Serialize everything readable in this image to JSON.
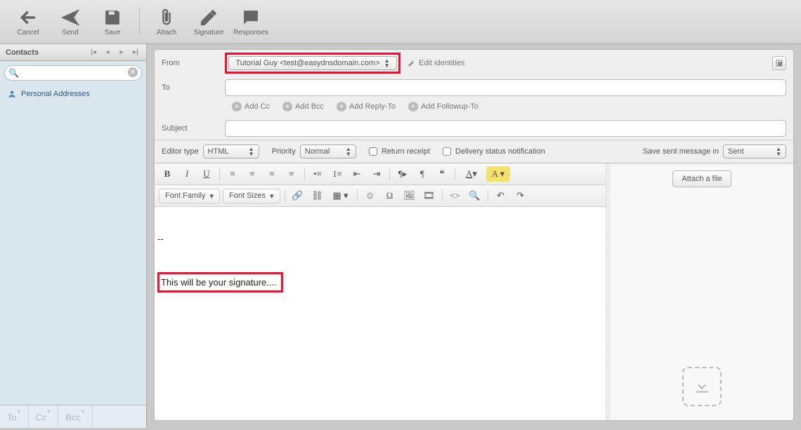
{
  "toolbar": {
    "cancel": "Cancel",
    "send": "Send",
    "save": "Save",
    "attach": "Attach",
    "signature": "Signature",
    "responses": "Responses"
  },
  "sidebar": {
    "title": "Contacts",
    "search_placeholder": "",
    "items": [
      {
        "label": "Personal Addresses"
      }
    ],
    "footer": {
      "to": "To",
      "cc": "Cc",
      "bcc": "Bcc"
    }
  },
  "compose": {
    "from_label": "From",
    "to_label": "To",
    "subject_label": "Subject",
    "from_value": "Tutorial Guy <test@easydnsdomain.com>",
    "edit_identities": "Edit identities",
    "add_cc": "Add Cc",
    "add_bcc": "Add Bcc",
    "add_replyto": "Add Reply-To",
    "add_followup": "Add Followup-To",
    "to_value": "",
    "subject_value": ""
  },
  "options": {
    "editor_type_label": "Editor type",
    "editor_type_value": "HTML",
    "priority_label": "Priority",
    "priority_value": "Normal",
    "return_receipt": "Return receipt",
    "dsn": "Delivery status notification",
    "save_in_label": "Save sent message in",
    "save_in_value": "Sent"
  },
  "editor": {
    "font_family": "Font Family",
    "font_sizes": "Font Sizes",
    "body_sep": "--",
    "signature_text": "This will be your signature...."
  },
  "attachments": {
    "attach_file": "Attach a file"
  }
}
